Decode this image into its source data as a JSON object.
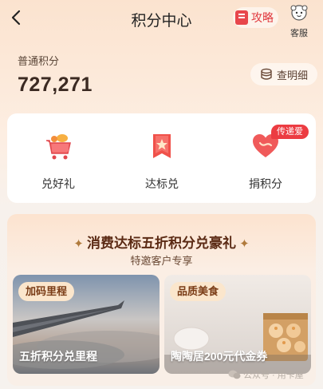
{
  "header": {
    "title": "积分中心",
    "guide_label": "攻略",
    "service_label": "客服"
  },
  "points": {
    "label": "普通积分",
    "value": "727,271",
    "detail_label": "查明细"
  },
  "actions": [
    {
      "label": "兑好礼",
      "icon": "gift-cart-icon"
    },
    {
      "label": "达标兑",
      "icon": "star-bookmark-icon"
    },
    {
      "label": "捐积分",
      "icon": "heart-donate-icon",
      "badge": "传递爱"
    }
  ],
  "promo": {
    "title": "消费达标五折积分兑豪礼",
    "subtitle": "特邀客户专享",
    "offers": [
      {
        "tag": "加码里程",
        "caption": "五折积分兑里程",
        "image": "airplane-wing-photo"
      },
      {
        "tag": "品质美食",
        "caption": "陶陶居200元代金券",
        "image": "dim-sum-photo"
      }
    ]
  },
  "watermark": {
    "text": "公众号 · 用卡屋"
  },
  "colors": {
    "accent_red": "#ec3c42",
    "brown_text": "#3b2a22",
    "promo_title": "#5b2a14"
  }
}
